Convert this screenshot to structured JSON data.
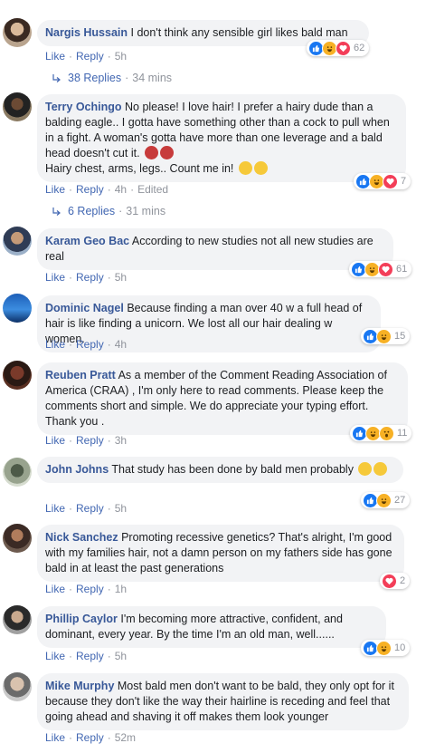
{
  "ui": {
    "like_label": "Like",
    "reply_label": "Reply",
    "edited_label": "Edited"
  },
  "comments": [
    {
      "author": "Nargis Hussain",
      "text": "I don't think any sensible girl likes bald man",
      "time": "5h",
      "reactions": [
        "like",
        "haha",
        "love"
      ],
      "count": "62",
      "replies": {
        "label": "38 Replies",
        "time": "34 mins"
      }
    },
    {
      "author": "Terry Ochingo",
      "text": "No please! I love hair! I prefer a hairy dude than a balding eagle.. I gotta have something other than a cock to pull when in a fight. A woman's gotta have more than one leverage and a bald head doesn't cut it.",
      "text2": "Hairy chest, arms, legs.. Count me in!",
      "time": "4h",
      "edited": true,
      "reactions": [
        "like",
        "haha",
        "love"
      ],
      "count": "7",
      "replies": {
        "label": "6 Replies",
        "time": "31 mins"
      }
    },
    {
      "author": "Karam Geo Bac",
      "text": "According to new studies not all new studies are real",
      "time": "5h",
      "reactions": [
        "like",
        "haha",
        "love"
      ],
      "count": "61"
    },
    {
      "author": "Dominic Nagel",
      "text": "Because finding a man over 40 w a full head of hair is like finding a unicorn. We lost all our hair dealing w women.",
      "time": "4h",
      "reactions": [
        "like",
        "haha"
      ],
      "count": "15"
    },
    {
      "author": "Reuben Pratt",
      "text": "As a member of the Comment Reading Association of America (CRAA) , I'm only here to read comments. Please keep the comments short and simple. We do appreciate your typing effort. Thank you .",
      "time": "3h",
      "reactions": [
        "like",
        "haha",
        "wow"
      ],
      "count": "11"
    },
    {
      "author": "John Johns",
      "text": "That study has been done by bald men probably",
      "time": "5h",
      "reactions": [
        "like",
        "haha"
      ],
      "count": "27"
    },
    {
      "author": "Nick Sanchez",
      "text": "Promoting recessive genetics? That's alright, I'm good with my families hair, not a damn person on my fathers side has gone bald in at least the past generations",
      "time": "1h",
      "reactions": [
        "love"
      ],
      "count": "2"
    },
    {
      "author": "Phillip Caylor",
      "text": "I'm becoming more attractive, confident, and dominant, every year. By the time I'm an old man, well......",
      "time": "5h",
      "reactions": [
        "like",
        "haha"
      ],
      "count": "10"
    },
    {
      "author": "Mike Murphy",
      "text": "Most bald men don't want to be bald, they only opt for it because they don't like the way their hairline is receding and feel that going ahead and shaving it off makes them look younger",
      "time": "52m"
    }
  ],
  "colors": {
    "link": "#4267b2",
    "author": "#385898",
    "bubble": "#f2f3f5",
    "like": "#1877f2",
    "love": "#f33e58",
    "haha": "#f7b125"
  }
}
